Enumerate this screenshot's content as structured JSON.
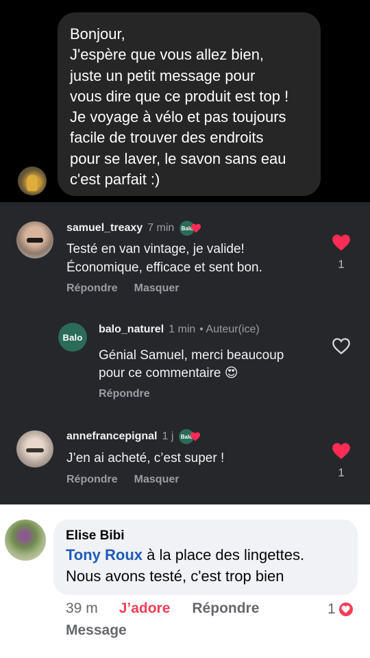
{
  "dm": {
    "lines": [
      "Bonjour,",
      "J'espère que vous allez bien,",
      "juste un petit message pour",
      "vous dire que ce produit est top !",
      "Je voyage à vélo et pas toujours",
      "facile de trouver des endroits",
      "pour se laver, le savon sans eau",
      "c'est parfait :)"
    ]
  },
  "thread": {
    "comments": [
      {
        "username": "samuel_treaxy",
        "time": "7 min",
        "liked_by_author_logo": "Balo",
        "text_lines": [
          "Testé en van vintage, je valide!",
          "Économique, efficace et sent bon."
        ],
        "reply_label": "Répondre",
        "hide_label": "Masquer",
        "like_count": "1",
        "liked": true
      },
      {
        "username": "balo_naturel",
        "time": "1 min",
        "author_tag": "• Auteur(ice)",
        "avatar_text": "Balo",
        "text_lines": [
          "Génial Samuel, merci beaucoup",
          "pour ce commentaire 😍"
        ],
        "reply_label": "Répondre",
        "liked": false
      },
      {
        "username": "annefrancepignal",
        "time": "1 j",
        "liked_by_author_logo": "Balo",
        "text_lines": [
          "J’en ai acheté, c’est super !"
        ],
        "reply_label": "Répondre",
        "hide_label": "Masquer",
        "like_count": "1",
        "liked": true
      }
    ]
  },
  "fb_comment": {
    "name": "Elise Bibi",
    "mention": "Tony Roux",
    "line1_rest": " à la place des lingettes.",
    "line2": "Nous avons testé, c'est trop bien",
    "time": "39 m",
    "love_label": "J’adore",
    "reply_label": "Répondre",
    "message_label": "Message",
    "reaction_count": "1"
  },
  "colors": {
    "heart_red": "#ff2d55",
    "balo_green": "#2b6b58",
    "fb_love": "#f33e58",
    "mention_blue": "#1e5bb8"
  },
  "icons": [
    "heart-filled-icon",
    "heart-outline-icon",
    "love-reaction-icon"
  ]
}
